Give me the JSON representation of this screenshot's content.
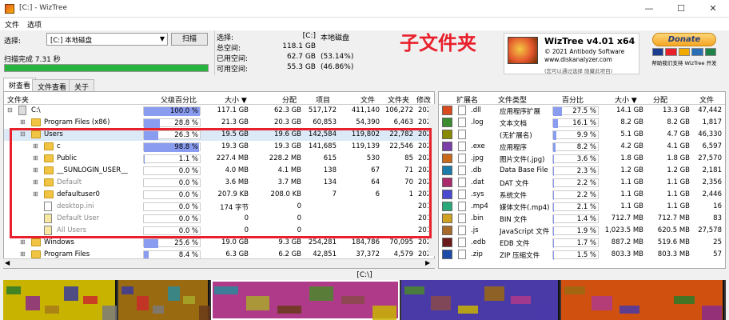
{
  "window": {
    "title": "[C:] - WizTree",
    "minimize": "—",
    "maximize": "☐",
    "close": "✕"
  },
  "menu": [
    "文件",
    "选项"
  ],
  "controls": {
    "select_label": "选择:",
    "drive": "[C:] 本地磁盘",
    "scan": "扫描",
    "status": "扫描完成 7.31 秒",
    "progress_pct": 100
  },
  "stats": {
    "rows": [
      {
        "label": "选择:",
        "value": "[C:]",
        "extra": "本地磁盘"
      },
      {
        "label": "总空间:",
        "value": "118.1 GB",
        "extra": ""
      },
      {
        "label": "已用空间:",
        "value": "62.7 GB",
        "extra": "(53.14%)"
      },
      {
        "label": "可用空间:",
        "value": "55.3 GB",
        "extra": "(46.86%)"
      }
    ]
  },
  "annotation": "子文件夹",
  "logo": {
    "title": "WizTree v4.01 x64",
    "copyright": "© 2021 Antibody Software",
    "url": "www.diskanalyzer.com",
    "foot": "(您可以通过选择 隐藏此项目)"
  },
  "donate": {
    "label": "Donate",
    "note": "帮助我们支持 WizTree 开发",
    "card_colors": [
      "#1a3d8f",
      "#e8202c",
      "#f2a900",
      "#2a6fb5",
      "#1d8348"
    ]
  },
  "tabs": [
    "树查看",
    "文件查看",
    "关于"
  ],
  "tree": {
    "headers": {
      "name": "文件夹",
      "pct": "父级百分比",
      "size": "大小 ▼",
      "alloc": "分配",
      "items": "项目",
      "files": "文件",
      "folders": "文件夹",
      "modified": "修改"
    },
    "rows": [
      {
        "exp": "⊟",
        "name": "C:\\",
        "pct": "100.0 %",
        "pct_v": 100,
        "size": "117.1 GB",
        "alloc": "62.3 GB",
        "items": "517,172",
        "files": "411,140",
        "folders": "106,272",
        "mod": "202",
        "indent": 0,
        "icon": "drive",
        "dim": false,
        "sel": false
      },
      {
        "exp": "⊞",
        "name": "Program Files (x86)",
        "pct": "28.8 %",
        "pct_v": 28.8,
        "size": "21.3 GB",
        "alloc": "20.3 GB",
        "items": "60,853",
        "files": "54,390",
        "folders": "6,463",
        "mod": "202",
        "indent": 1,
        "icon": "folder",
        "dim": false,
        "sel": false
      },
      {
        "exp": "⊟",
        "name": "Users",
        "pct": "26.3 %",
        "pct_v": 26.3,
        "size": "19.5 GB",
        "alloc": "19.6 GB",
        "items": "142,584",
        "files": "119,802",
        "folders": "22,782",
        "mod": "202",
        "indent": 1,
        "icon": "folder",
        "dim": false,
        "sel": true
      },
      {
        "exp": "⊞",
        "name": "c",
        "pct": "98.8 %",
        "pct_v": 98.8,
        "size": "19.3 GB",
        "alloc": "19.3 GB",
        "items": "141,685",
        "files": "119,139",
        "folders": "22,546",
        "mod": "202",
        "indent": 2,
        "icon": "folder",
        "dim": false,
        "sel": false
      },
      {
        "exp": "⊞",
        "name": "Public",
        "pct": "1.1 %",
        "pct_v": 1.1,
        "size": "227.4 MB",
        "alloc": "228.2 MB",
        "items": "615",
        "files": "530",
        "folders": "85",
        "mod": "202",
        "indent": 2,
        "icon": "folder",
        "dim": false,
        "sel": false
      },
      {
        "exp": "⊞",
        "name": "__SUNLOGIN_USER__",
        "pct": "0.0 %",
        "pct_v": 0,
        "size": "4.0 MB",
        "alloc": "4.1 MB",
        "items": "138",
        "files": "67",
        "folders": "71",
        "mod": "202",
        "indent": 2,
        "icon": "folder",
        "dim": false,
        "sel": false
      },
      {
        "exp": "⊞",
        "name": "Default",
        "pct": "0.0 %",
        "pct_v": 0,
        "size": "3.6 MB",
        "alloc": "3.7 MB",
        "items": "134",
        "files": "64",
        "folders": "70",
        "mod": "202",
        "indent": 2,
        "icon": "folder",
        "dim": true,
        "sel": false
      },
      {
        "exp": "⊞",
        "name": "defaultuser0",
        "pct": "0.0 %",
        "pct_v": 0,
        "size": "207.9 KB",
        "alloc": "208.0 KB",
        "items": "7",
        "files": "6",
        "folders": "1",
        "mod": "202",
        "indent": 2,
        "icon": "folder",
        "dim": false,
        "sel": false
      },
      {
        "exp": "",
        "name": "desktop.ini",
        "pct": "0.0 %",
        "pct_v": 0,
        "size": "174 字节",
        "alloc": "0",
        "items": "",
        "files": "",
        "folders": "",
        "mod": "201",
        "indent": 2,
        "icon": "file",
        "dim": true,
        "sel": false
      },
      {
        "exp": "",
        "name": "Default User",
        "pct": "0.0 %",
        "pct_v": 0,
        "size": "0",
        "alloc": "0",
        "items": "",
        "files": "",
        "folders": "",
        "mod": "201",
        "indent": 2,
        "icon": "link",
        "dim": true,
        "sel": false
      },
      {
        "exp": "",
        "name": "All Users",
        "pct": "0.0 %",
        "pct_v": 0,
        "size": "0",
        "alloc": "0",
        "items": "",
        "files": "",
        "folders": "",
        "mod": "201",
        "indent": 2,
        "icon": "link",
        "dim": true,
        "sel": false
      },
      {
        "exp": "⊞",
        "name": "Windows",
        "pct": "25.6 %",
        "pct_v": 25.6,
        "size": "19.0 GB",
        "alloc": "9.3 GB",
        "items": "254,281",
        "files": "184,786",
        "folders": "70,095",
        "mod": "202",
        "indent": 1,
        "icon": "folder",
        "dim": false,
        "sel": false
      },
      {
        "exp": "⊞",
        "name": "Program Files",
        "pct": "8.4 %",
        "pct_v": 8.4,
        "size": "6.3 GB",
        "alloc": "6.2 GB",
        "items": "42,851",
        "files": "37,372",
        "folders": "4,579",
        "mod": "202",
        "indent": 1,
        "icon": "folder",
        "dim": false,
        "sel": false
      }
    ]
  },
  "ext": {
    "headers": {
      "ext": "扩展名",
      "type": "文件类型",
      "pct": "百分比",
      "size": "大小 ▼",
      "alloc": "分配",
      "files": "文件"
    },
    "rows": [
      {
        "color": "#d94a1e",
        "ext": ".dll",
        "type": "应用程序扩展",
        "pct": "27.5 %",
        "pct_v": 27.5,
        "size": "14.1 GB",
        "alloc": "13.3 GB",
        "files": "47,442"
      },
      {
        "color": "#3a8c2f",
        "ext": ".log",
        "type": "文本文档",
        "pct": "16.1 %",
        "pct_v": 16.1,
        "size": "8.2 GB",
        "alloc": "8.2 GB",
        "files": "1,817"
      },
      {
        "color": "#8a8a00",
        "ext": "",
        "type": "(无扩展名)",
        "pct": "9.9 %",
        "pct_v": 9.9,
        "size": "5.1 GB",
        "alloc": "4.7 GB",
        "files": "46,330"
      },
      {
        "color": "#7b3fa8",
        "ext": ".exe",
        "type": "应用程序",
        "pct": "8.2 %",
        "pct_v": 8.2,
        "size": "4.2 GB",
        "alloc": "4.1 GB",
        "files": "6,597"
      },
      {
        "color": "#c86a1a",
        "ext": ".jpg",
        "type": "图片文件(.jpg)",
        "pct": "3.6 %",
        "pct_v": 3.6,
        "size": "1.8 GB",
        "alloc": "1.8 GB",
        "files": "27,570"
      },
      {
        "color": "#1a7aa8",
        "ext": ".db",
        "type": "Data Base File",
        "pct": "2.3 %",
        "pct_v": 2.3,
        "size": "1.2 GB",
        "alloc": "1.2 GB",
        "files": "2,181"
      },
      {
        "color": "#a82a6a",
        "ext": ".dat",
        "type": "DAT 文件",
        "pct": "2.2 %",
        "pct_v": 2.2,
        "size": "1.1 GB",
        "alloc": "1.1 GB",
        "files": "2,356"
      },
      {
        "color": "#4a4ad0",
        "ext": ".sys",
        "type": "系统文件",
        "pct": "2.2 %",
        "pct_v": 2.2,
        "size": "1.1 GB",
        "alloc": "1.1 GB",
        "files": "2,446"
      },
      {
        "color": "#2aa87a",
        "ext": ".mp4",
        "type": "媒体文件(.mp4)",
        "pct": "2.1 %",
        "pct_v": 2.1,
        "size": "1.1 GB",
        "alloc": "1.1 GB",
        "files": "16"
      },
      {
        "color": "#d0a020",
        "ext": ".bin",
        "type": "BIN 文件",
        "pct": "1.4 %",
        "pct_v": 1.4,
        "size": "712.7 MB",
        "alloc": "712.7 MB",
        "files": "83"
      },
      {
        "color": "#a86a2a",
        "ext": ".js",
        "type": "JavaScript 文件",
        "pct": "1.9 %",
        "pct_v": 1.9,
        "size": "1,023.5 MB",
        "alloc": "620.5 MB",
        "files": "27,578"
      },
      {
        "color": "#6a1a1a",
        "ext": ".edb",
        "type": "EDB 文件",
        "pct": "1.7 %",
        "pct_v": 1.7,
        "size": "887.2 MB",
        "alloc": "519.6 MB",
        "files": "25"
      },
      {
        "color": "#1a4aa8",
        "ext": ".zip",
        "type": "ZIP 压缩文件",
        "pct": "1.5 %",
        "pct_v": 1.5,
        "size": "803.3 MB",
        "alloc": "803.3 MB",
        "files": "57"
      }
    ]
  },
  "path": "[C:\\]",
  "treemap_colors": [
    "#c8b400",
    "#9a6a10",
    "#b03a8a",
    "#4a3aa8",
    "#d05010",
    "#2a7a2a",
    "#8a2a8a",
    "#a87a1a",
    "#3a3a9a",
    "#c82a2a",
    "#7a7a7a",
    "#2a8a9a",
    "#a8a82a",
    "#6a3a1a",
    "#4a8a2a",
    "#8a4a4a"
  ]
}
